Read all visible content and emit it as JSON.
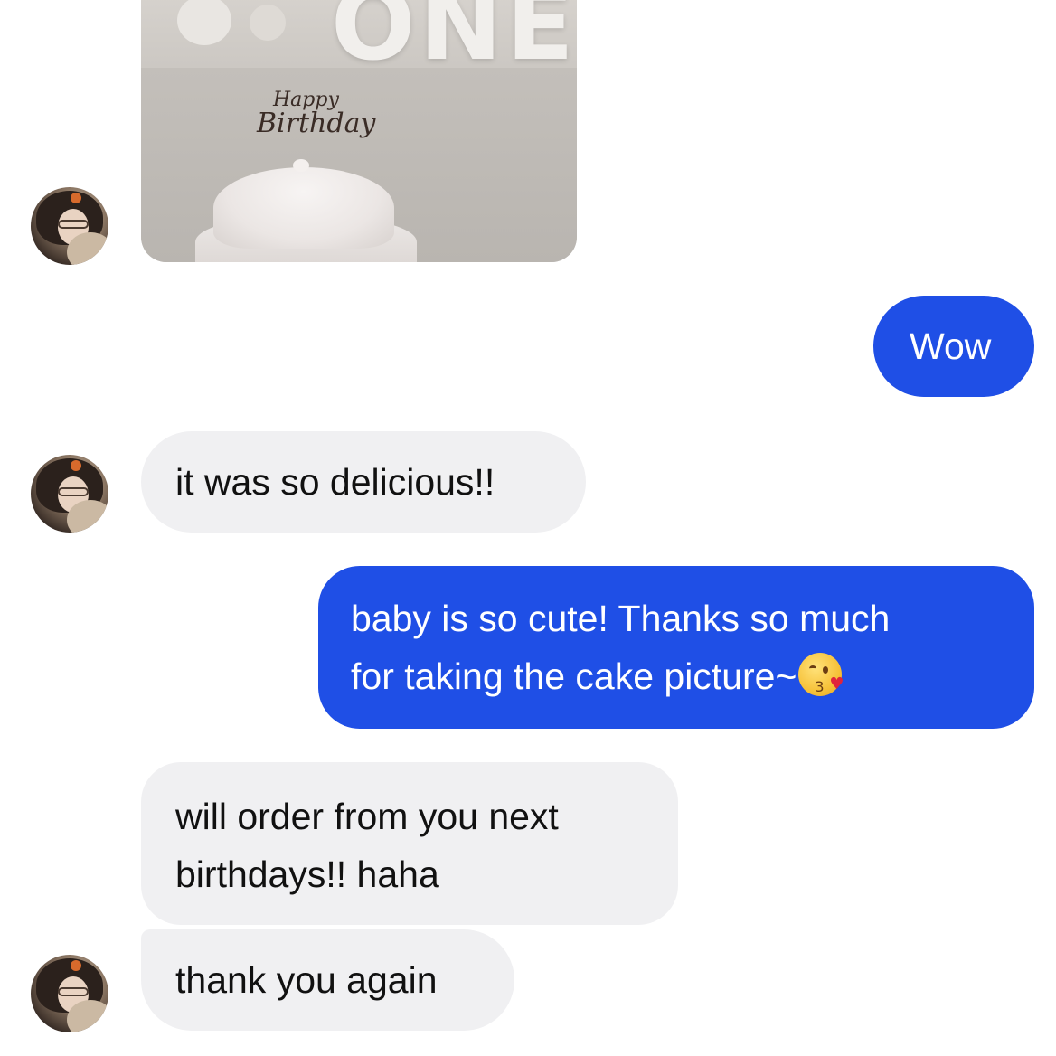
{
  "photo": {
    "letters": "ONE",
    "topper_line1": "Happy",
    "topper_line2": "Birthday"
  },
  "messages": [
    {
      "direction": "outgoing",
      "text": "Wow"
    },
    {
      "direction": "incoming",
      "text": "it was so delicious!!"
    },
    {
      "direction": "outgoing",
      "line1": "baby is so cute! Thanks so much",
      "line2": "for taking the cake picture~",
      "emoji": "kissing-face-heart-emoji"
    },
    {
      "direction": "incoming",
      "line1": "will order from you next",
      "line2": "birthdays!! haha"
    },
    {
      "direction": "incoming",
      "text": "thank you again"
    }
  ],
  "colors": {
    "outgoing_bubble": "#1f4fe6",
    "incoming_bubble": "#f0f0f2"
  }
}
